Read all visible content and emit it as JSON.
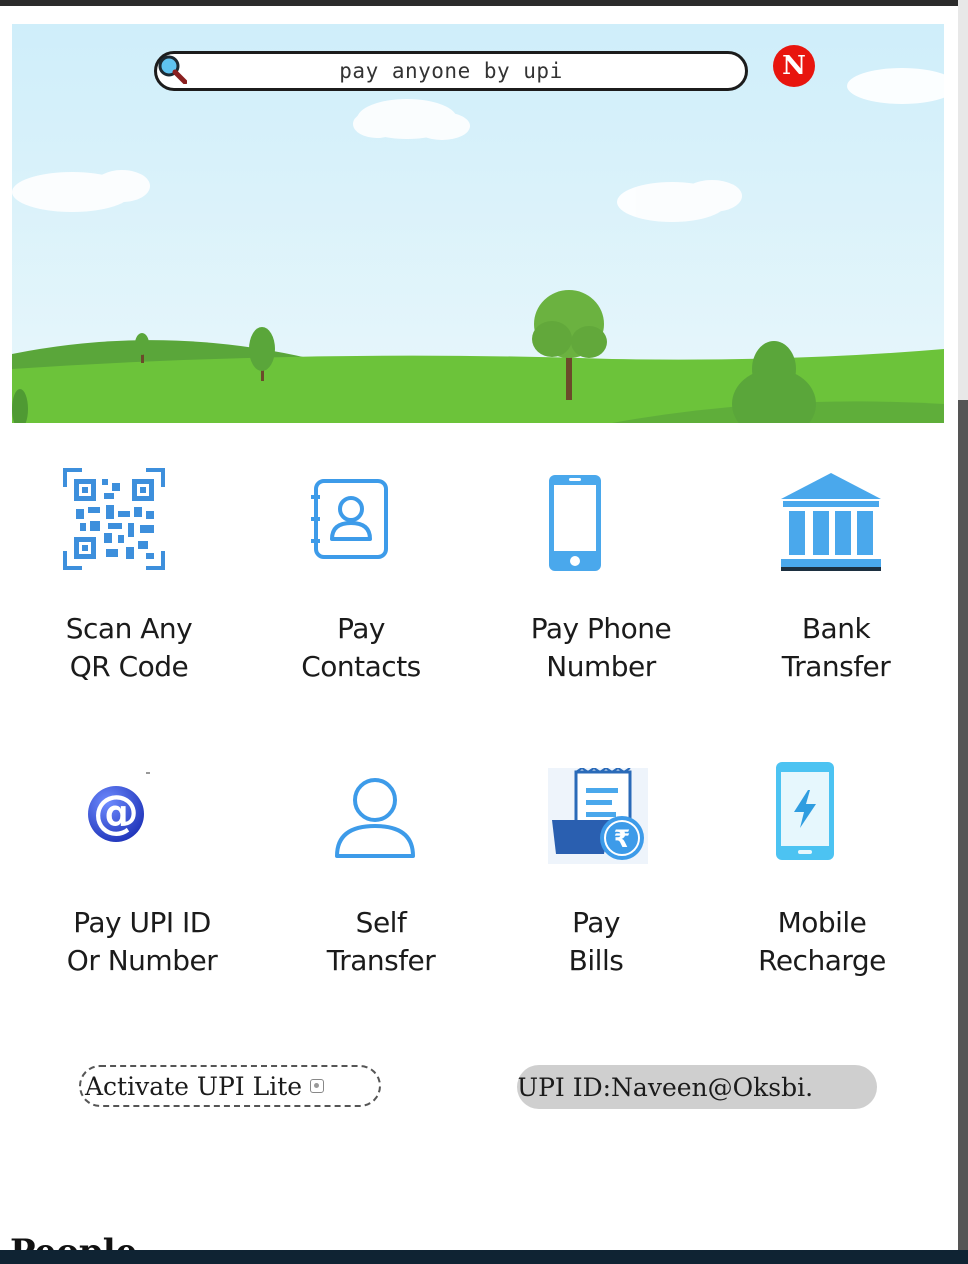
{
  "search": {
    "placeholder": "pay anyone by upi",
    "icon": "search-icon"
  },
  "profile": {
    "initial": "N",
    "color": "#e8150e"
  },
  "actions_row1": [
    {
      "label_line1": "Scan Any",
      "label_line2": "QR Code",
      "icon": "qr-code-icon"
    },
    {
      "label_line1": "Pay",
      "label_line2": "Contacts",
      "icon": "contacts-icon"
    },
    {
      "label_line1": "Pay Phone",
      "label_line2": "Number",
      "icon": "phone-icon"
    },
    {
      "label_line1": "Bank",
      "label_line2": "Transfer",
      "icon": "bank-icon"
    }
  ],
  "actions_row2": [
    {
      "label_line1": "Pay UPI ID",
      "label_line2": "Or Number",
      "icon": "at-sign-icon"
    },
    {
      "label_line1": "Self",
      "label_line2": "Transfer",
      "icon": "user-icon"
    },
    {
      "label_line1": "Pay",
      "label_line2": "Bills",
      "icon": "bill-icon"
    },
    {
      "label_line1": "Mobile",
      "label_line2": "Recharge",
      "icon": "mobile-recharge-icon"
    }
  ],
  "upi_lite": {
    "label": "Activate UPI Lite"
  },
  "upi_id": {
    "label": "UPI ID:Naveen@Oksbi."
  },
  "people": {
    "title": "People"
  },
  "colors": {
    "accent_blue": "#3d9be9",
    "sky": "#dff3fb",
    "grass": "#6cc33a"
  }
}
